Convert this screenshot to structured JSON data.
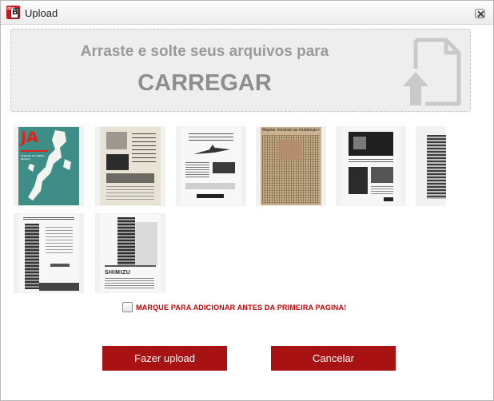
{
  "window": {
    "title": "Upload",
    "icon": "app-logo-icon",
    "icon_tag": "doc"
  },
  "dropzone": {
    "line1": "Arraste e solte seus arquivos para",
    "line2": "CARREGAR",
    "icon": "file-upload-icon"
  },
  "thumbnails": [
    {
      "name": "thumbnail-1",
      "headline": "JA",
      "subhead": "LINEAGE OF URBAN DESIGN"
    },
    {
      "name": "thumbnail-2"
    },
    {
      "name": "thumbnail-3"
    },
    {
      "name": "thumbnail-4",
      "headline": "Mapear mostram as mudanças no cidad"
    },
    {
      "name": "thumbnail-5"
    },
    {
      "name": "thumbnail-6"
    },
    {
      "name": "thumbnail-7"
    },
    {
      "name": "thumbnail-8",
      "headline": "SHIMIZU"
    }
  ],
  "options": {
    "prepend_label": "MARQUE PARA ADICIONAR ANTES DA PRIMEIRA PAGINA!",
    "prepend_checked": false
  },
  "actions": {
    "upload_label": "Fazer upload",
    "cancel_label": "Cancelar"
  },
  "colors": {
    "accent": "#a81212",
    "warning_text": "#cc0000",
    "dropzone_bg": "#eeeeee"
  }
}
